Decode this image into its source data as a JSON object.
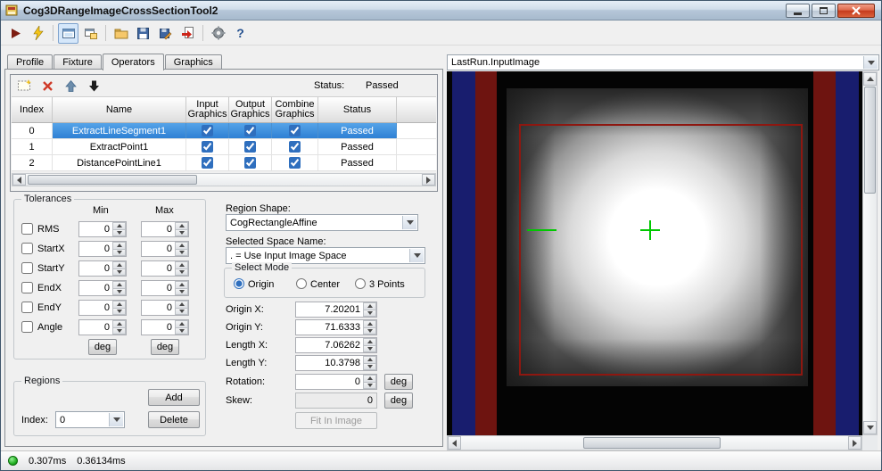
{
  "window": {
    "title": "Cog3DRangeImageCrossSectionTool2"
  },
  "toolbar": {
    "buttons": [
      "run",
      "run-electric",
      "image-display-toggle",
      "float-window",
      "open",
      "save",
      "save-as",
      "import",
      "settings",
      "help"
    ],
    "pressed": "image-display-toggle"
  },
  "tabs": {
    "items": [
      {
        "label": "Profile"
      },
      {
        "label": "Fixture"
      },
      {
        "label": "Operators"
      },
      {
        "label": "Graphics"
      }
    ],
    "active_index": 2
  },
  "operators": {
    "status_label": "Status:",
    "status_value": "Passed",
    "grid": {
      "headers": {
        "index": "Index",
        "name": "Name",
        "input": "Input Graphics",
        "output": "Output Graphics",
        "combine": "Combine Graphics",
        "status": "Status"
      },
      "rows": [
        {
          "index": "0",
          "name": "ExtractLineSegment1",
          "input_graphics": true,
          "output_graphics": true,
          "combine_graphics": true,
          "status": "Passed",
          "selected": true
        },
        {
          "index": "1",
          "name": "ExtractPoint1",
          "input_graphics": true,
          "output_graphics": true,
          "combine_graphics": true,
          "status": "Passed",
          "selected": false
        },
        {
          "index": "2",
          "name": "DistancePointLine1",
          "input_graphics": true,
          "output_graphics": true,
          "combine_graphics": true,
          "status": "Passed",
          "selected": false
        }
      ]
    }
  },
  "tolerances": {
    "title": "Tolerances",
    "min_header": "Min",
    "max_header": "Max",
    "deg_label": "deg",
    "rows": [
      {
        "label": "RMS",
        "checked": false,
        "min": "0",
        "max": "0"
      },
      {
        "label": "StartX",
        "checked": false,
        "min": "0",
        "max": "0"
      },
      {
        "label": "StartY",
        "checked": false,
        "min": "0",
        "max": "0"
      },
      {
        "label": "EndX",
        "checked": false,
        "min": "0",
        "max": "0"
      },
      {
        "label": "EndY",
        "checked": false,
        "min": "0",
        "max": "0"
      },
      {
        "label": "Angle",
        "checked": false,
        "min": "0",
        "max": "0"
      }
    ]
  },
  "regions": {
    "title": "Regions",
    "index_label": "Index:",
    "index_value": "0",
    "add_label": "Add",
    "delete_label": "Delete"
  },
  "region_shape": {
    "shape_label": "Region Shape:",
    "shape_value": "CogRectangleAffine",
    "space_label": "Selected Space Name:",
    "space_value": ". = Use Input Image Space",
    "mode": {
      "title": "Select Mode",
      "options": [
        {
          "label": "Origin",
          "selected": true
        },
        {
          "label": "Center",
          "selected": false
        },
        {
          "label": "3 Points",
          "selected": false
        }
      ]
    },
    "fields": {
      "origin_x_label": "Origin X:",
      "origin_x": "7.20201",
      "origin_y_label": "Origin Y:",
      "origin_y": "71.6333",
      "length_x_label": "Length X:",
      "length_x": "7.06262",
      "length_y_label": "Length Y:",
      "length_y": "10.3798",
      "rotation_label": "Rotation:",
      "rotation": "0",
      "skew_label": "Skew:",
      "skew": "0"
    },
    "deg_label": "deg",
    "fit_button_label": "Fit In Image"
  },
  "display": {
    "source": "LastRun.InputImage",
    "colors": {
      "stripe_blue": "#181d6e",
      "stripe_red": "#6e1410",
      "region_outline": "#8e1710",
      "marker_green": "#00c800"
    }
  },
  "statusbar": {
    "time_total": "0.307ms",
    "time_last": "0.36134ms"
  }
}
